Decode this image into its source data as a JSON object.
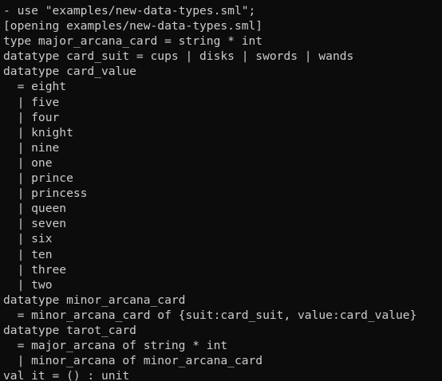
{
  "terminal": {
    "lines": [
      "- use \"examples/new-data-types.sml\";",
      "[opening examples/new-data-types.sml]",
      "type major_arcana_card = string * int",
      "datatype card_suit = cups | disks | swords | wands",
      "datatype card_value",
      "  = eight",
      "  | five",
      "  | four",
      "  | knight",
      "  | nine",
      "  | one",
      "  | prince",
      "  | princess",
      "  | queen",
      "  | seven",
      "  | six",
      "  | ten",
      "  | three",
      "  | two",
      "datatype minor_arcana_card",
      "  = minor_arcana_card of {suit:card_suit, value:card_value}",
      "datatype tarot_card",
      "  = major_arcana of string * int",
      "  | minor_arcana of minor_arcana_card",
      "val it = () : unit"
    ]
  }
}
